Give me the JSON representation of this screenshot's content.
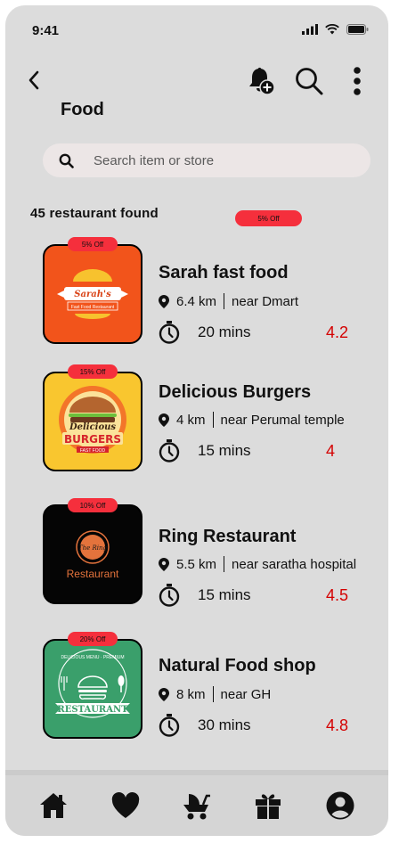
{
  "status_bar": {
    "time": "9:41"
  },
  "header": {
    "title": "Food"
  },
  "search": {
    "placeholder": "Search item or store"
  },
  "results": {
    "count_text": "45 restaurant found",
    "floating_badge": "5% Off"
  },
  "restaurants": [
    {
      "name": "Sarah fast food",
      "distance": "6.4 km",
      "location": "near Dmart",
      "time": "20 mins",
      "rating": "4.2",
      "discount": "5% Off",
      "logo_line1": "Sarah's",
      "logo_line2": "Fast Food Restaurant"
    },
    {
      "name": "Delicious Burgers",
      "distance": "4 km",
      "location": "near Perumal temple",
      "time": "15 mins",
      "rating": "4",
      "discount": "15% Off",
      "logo_line1": "Delicious",
      "logo_line2": "BURGERS",
      "logo_line3": "FAST FOOD"
    },
    {
      "name": "Ring Restaurant",
      "distance": "5.5 km",
      "location": "near saratha hospital",
      "time": "15 mins",
      "rating": "4.5",
      "discount": "10% Off",
      "logo_line1": "The Ring",
      "logo_line2": "Restaurant"
    },
    {
      "name": "Natural Food shop",
      "distance": "8 km",
      "location": "near GH",
      "time": "30 mins",
      "rating": "4.8",
      "discount": "20% Off",
      "logo_line1": "DELICIOUS MENU · PREMIUM",
      "logo_line2": "RESTAURANT"
    }
  ],
  "bottom_nav": [
    "home-icon",
    "heart-icon",
    "stroller-icon",
    "gift-icon",
    "profile-icon"
  ],
  "colors": {
    "background": "#dcdcdc",
    "badge": "#f52f3c",
    "rating": "#d40000"
  }
}
